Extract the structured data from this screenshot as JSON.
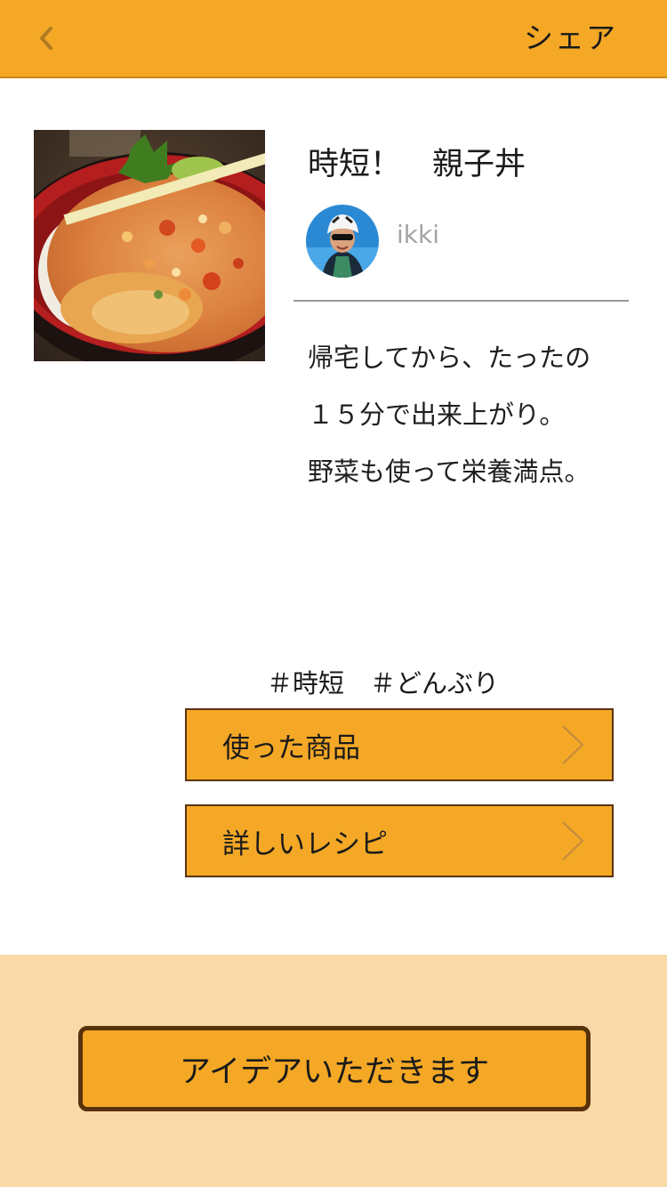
{
  "header": {
    "share_label": "シェア",
    "back_icon": "chevron-left-icon",
    "background": "#f4a826"
  },
  "recipe": {
    "title": "時短！　親子丼",
    "author": "ikki",
    "description": [
      "帰宅してから、たったの",
      "１５分で出来上がり。",
      "野菜も使って栄養満点。"
    ],
    "hashtags": [
      "＃時短",
      "＃どんぶり"
    ]
  },
  "actions": {
    "products_label": "使った商品",
    "recipe_label": "詳しいレシピ",
    "chevron_icon": "chevron-right-icon"
  },
  "cta": {
    "label": "アイデアいただきます",
    "panel_color": "#f9d9a8"
  }
}
